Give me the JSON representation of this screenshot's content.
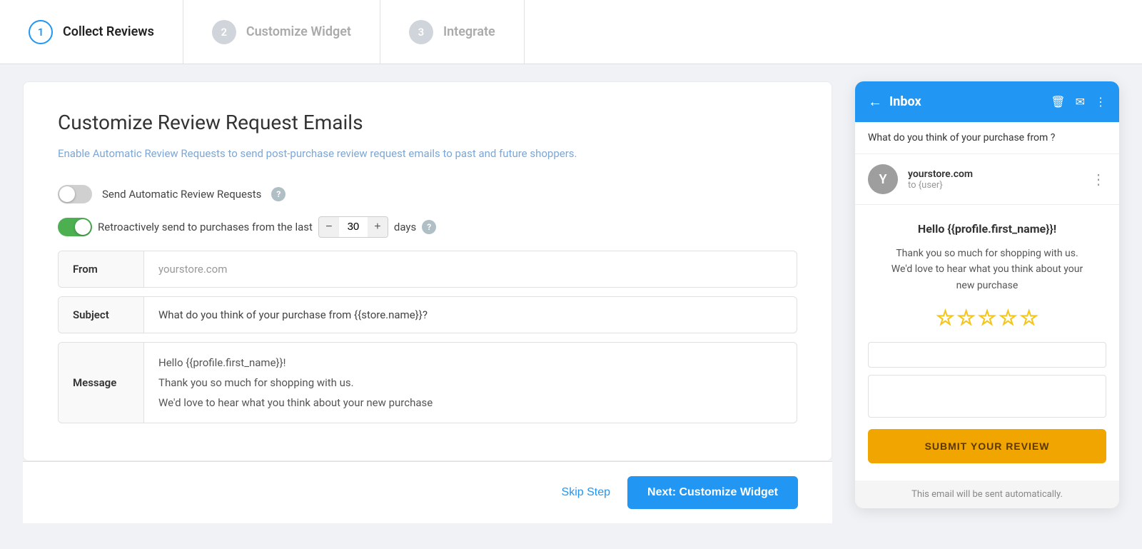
{
  "stepper": {
    "steps": [
      {
        "number": "1",
        "label": "Collect Reviews",
        "state": "active"
      },
      {
        "number": "2",
        "label": "Customize Widget",
        "state": "inactive"
      },
      {
        "number": "3",
        "label": "Integrate",
        "state": "inactive"
      }
    ]
  },
  "form": {
    "title": "Customize Review Request Emails",
    "subtitle": "Enable Automatic Review Requests to send post-purchase review request emails to past and future shoppers.",
    "toggle_auto_label": "Send Automatic Review Requests",
    "toggle_retro_label": "Retroactively send to purchases from the last",
    "days_value": "30",
    "days_unit": "days",
    "from_label": "From",
    "from_placeholder": "yourstore.com",
    "subject_label": "Subject",
    "subject_value": "What do you think of your purchase from {{store.name}}?",
    "message_label": "Message",
    "message_line1": "Hello {{profile.first_name}}!",
    "message_line2": "Thank you so much for shopping with us.",
    "message_line3": "We'd love to hear what you think about your new purchase"
  },
  "actions": {
    "skip_label": "Skip Step",
    "next_label": "Next: Customize Widget"
  },
  "email_preview": {
    "header_title": "Inbox",
    "subject_preview": "What do you think of your purchase from ?",
    "sender_avatar_letter": "Y",
    "sender_name": "yourstore.com",
    "sender_to": "to {user}",
    "greeting": "Hello {{profile.first_name}}!",
    "body_text_1": "Thank you so much for shopping with us.",
    "body_text_2": "We'd love to hear what you think about your",
    "body_text_3": "new purchase",
    "submit_label": "SUBMIT YOUR REVIEW",
    "footer_note": "This email will be sent automatically."
  }
}
